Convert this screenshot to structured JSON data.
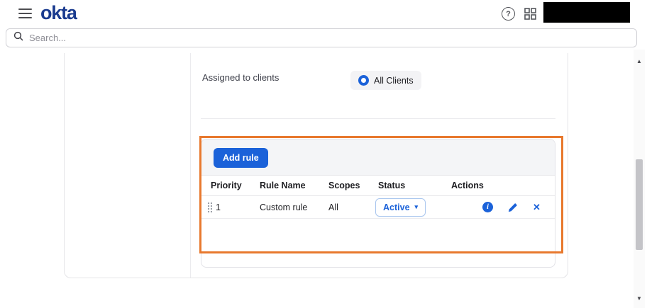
{
  "topbar": {
    "logo_text": "okta"
  },
  "search": {
    "placeholder": "Search..."
  },
  "content": {
    "assigned_to_clients_label": "Assigned to clients",
    "all_clients_chip": "All Clients"
  },
  "rules_panel": {
    "add_rule_button": "Add rule",
    "table": {
      "headers": {
        "priority": "Priority",
        "rule_name": "Rule Name",
        "scopes": "Scopes",
        "status": "Status",
        "actions": "Actions"
      },
      "row": {
        "priority": "1",
        "rule_name": "Custom rule",
        "scopes": "All",
        "status": "Active"
      }
    }
  },
  "icons": {
    "help": "?",
    "info": "i",
    "close": "✕",
    "caret_down": "▾",
    "scroll_up": "▲",
    "scroll_down": "▼"
  },
  "colors": {
    "brand_navy": "#1a3b8f",
    "primary_blue": "#1b62d9",
    "highlight_orange": "#e8792e",
    "panel_header_gray": "#f4f5f7"
  }
}
